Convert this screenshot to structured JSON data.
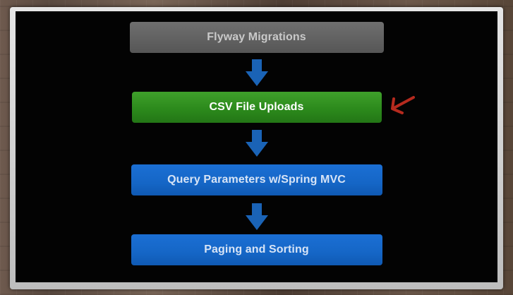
{
  "diagram": {
    "steps": [
      {
        "label": "Flyway Migrations",
        "state": "done"
      },
      {
        "label": "CSV File Uploads",
        "state": "current"
      },
      {
        "label": "Query Parameters w/Spring MVC",
        "state": "upcoming"
      },
      {
        "label": "Paging and Sorting",
        "state": "upcoming"
      }
    ],
    "colors": {
      "done": "#606060",
      "current": "#2f8f1f",
      "upcoming": "#1566c6",
      "connector_arrow": "#1a63b6",
      "pointer_arrow": "#b52a1e"
    }
  }
}
